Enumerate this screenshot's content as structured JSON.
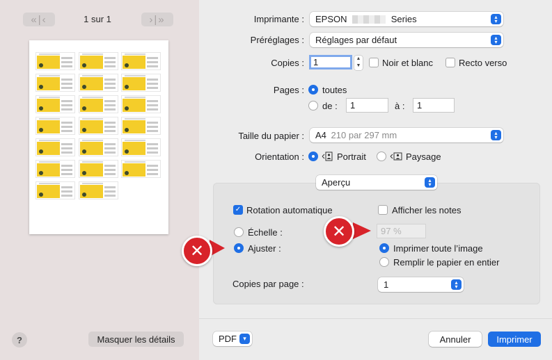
{
  "preview": {
    "prev_label": "«|‹",
    "next_label": "›|»",
    "page_indicator": "1 sur 1",
    "help_label": "?",
    "hide_details_label": "Masquer les détails"
  },
  "printer": {
    "label": "Imprimante :",
    "value_brand": "EPSON",
    "value_suffix": "Series"
  },
  "presets": {
    "label": "Préréglages :",
    "value": "Réglages par défaut"
  },
  "copies": {
    "label": "Copies :",
    "value": "1",
    "bw_label": "Noir et blanc",
    "duplex_label": "Recto verso"
  },
  "pages": {
    "label": "Pages :",
    "all_label": "toutes",
    "from_label": "de :",
    "from_value": "1",
    "to_label": "à :",
    "to_value": "1"
  },
  "paper": {
    "label": "Taille du papier :",
    "value": "A4",
    "dims": "210 par 297 mm"
  },
  "orientation": {
    "label": "Orientation :",
    "portrait_label": "Portrait",
    "landscape_label": "Paysage"
  },
  "section_popup": {
    "value": "Aperçu"
  },
  "preview_options": {
    "auto_rotate_label": "Rotation automatique",
    "show_notes_label": "Afficher les notes",
    "scale_label": "Échelle :",
    "scale_value": "97 %",
    "fit_label": "Ajuster :",
    "print_entire_label": "Imprimer toute l’image",
    "fill_paper_label": "Remplir le papier en entier",
    "copies_per_page_label": "Copies par page :",
    "copies_per_page_value": "1"
  },
  "footer": {
    "pdf_label": "PDF",
    "cancel_label": "Annuler",
    "print_label": "Imprimer"
  },
  "annotations": {
    "mark": "✕"
  },
  "colors": {
    "accent": "#1f6fe5",
    "badge": "#d8232a",
    "thumb_yellow": "#f4cd2a"
  }
}
